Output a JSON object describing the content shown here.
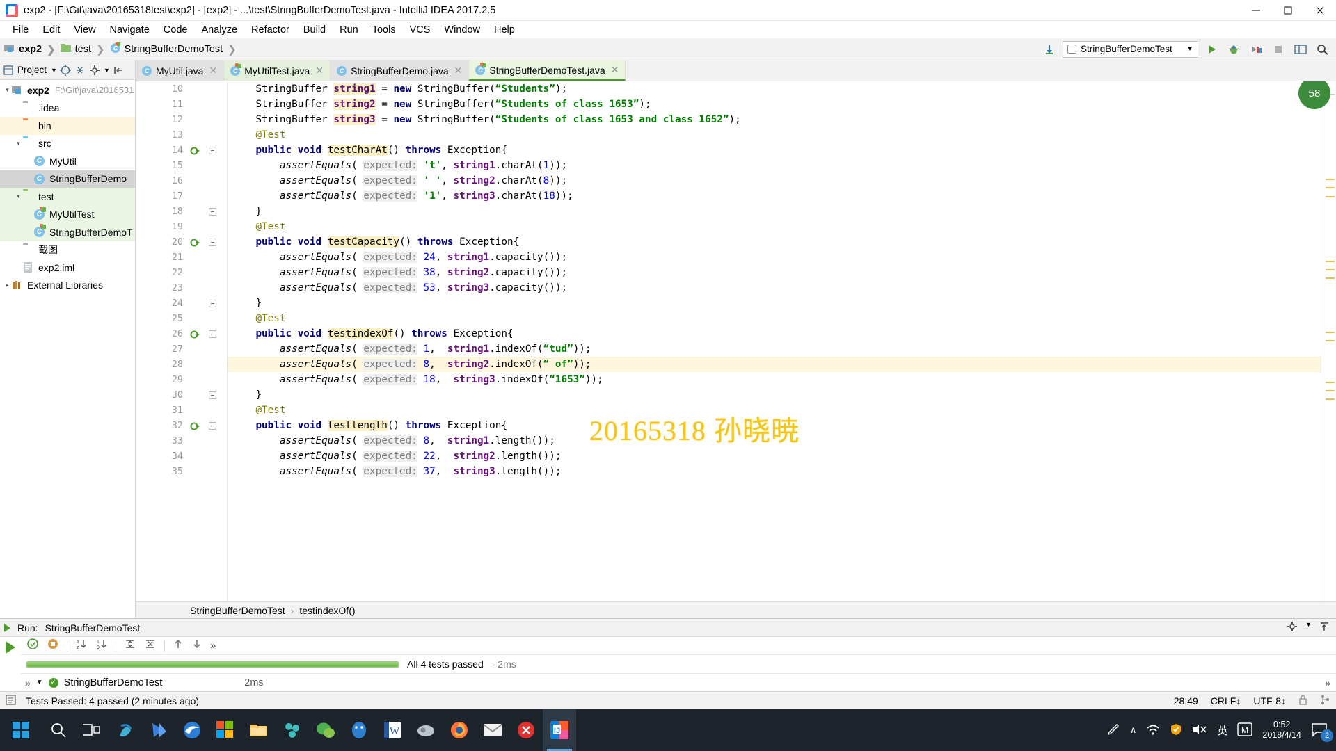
{
  "window": {
    "title": "exp2 - [F:\\Git\\java\\20165318test\\exp2] - [exp2] - ...\\test\\StringBufferDemoTest.java - IntelliJ IDEA 2017.2.5",
    "minimize_label": "─",
    "maximize_label": "❐",
    "close_label": "✕",
    "app_icon": "intellij-idea-icon"
  },
  "menubar": {
    "items": [
      "File",
      "Edit",
      "View",
      "Navigate",
      "Code",
      "Analyze",
      "Refactor",
      "Build",
      "Run",
      "Tools",
      "VCS",
      "Window",
      "Help"
    ]
  },
  "navbar": {
    "breadcrumbs": [
      {
        "label": "exp2",
        "icon": "module-icon"
      },
      {
        "label": "test",
        "icon": "folder-green-icon"
      },
      {
        "label": "StringBufferDemoTest",
        "icon": "test-class-icon"
      }
    ],
    "download_icon": "download-arrow-icon",
    "run_configuration": "StringBufferDemoTest",
    "run_icon": "run-green-triangle",
    "debug_icon": "debug-bug-icon",
    "coverage_icon": "run-with-coverage-icon",
    "stop_icon": "stop-square-icon",
    "layout_icon": "layout-icon",
    "search_icon": "search-icon"
  },
  "sidebar": {
    "title": "Project",
    "header_icons": [
      "project-view-icon",
      "target-icon",
      "collapse-all-icon",
      "gear-icon",
      "hide-icon"
    ],
    "tree": [
      {
        "label": "exp2",
        "sub": "F:\\Git\\java\\2016531",
        "icon": "module-icon",
        "indent": 0,
        "bold": true,
        "arrow": "▾",
        "state": "none"
      },
      {
        "label": ".idea",
        "sub": "",
        "icon": "folder-gray-icon",
        "indent": 1,
        "bold": false,
        "arrow": "",
        "state": "none"
      },
      {
        "label": "bin",
        "sub": "",
        "icon": "folder-orange-icon",
        "indent": 1,
        "bold": false,
        "arrow": "",
        "state": "ylw"
      },
      {
        "label": "src",
        "sub": "",
        "icon": "folder-blue-icon",
        "indent": 1,
        "bold": false,
        "arrow": "▾",
        "state": "none"
      },
      {
        "label": "MyUtil",
        "sub": "",
        "icon": "class-icon",
        "indent": 2,
        "bold": false,
        "arrow": "",
        "state": "none"
      },
      {
        "label": "StringBufferDemo",
        "sub": "",
        "icon": "class-icon",
        "indent": 2,
        "bold": false,
        "arrow": "",
        "state": "sel"
      },
      {
        "label": "test",
        "sub": "",
        "icon": "folder-green-icon",
        "indent": 1,
        "bold": false,
        "arrow": "▾",
        "state": "grn"
      },
      {
        "label": "MyUtilTest",
        "sub": "",
        "icon": "test-class-icon",
        "indent": 2,
        "bold": false,
        "arrow": "",
        "state": "grn"
      },
      {
        "label": "StringBufferDemoT",
        "sub": "",
        "icon": "test-class-icon",
        "indent": 2,
        "bold": false,
        "arrow": "",
        "state": "grn"
      },
      {
        "label": "截图",
        "sub": "",
        "icon": "folder-gray-icon",
        "indent": 1,
        "bold": false,
        "arrow": "",
        "state": "none"
      },
      {
        "label": "exp2.iml",
        "sub": "",
        "icon": "iml-icon",
        "indent": 1,
        "bold": false,
        "arrow": "",
        "state": "none"
      },
      {
        "label": "External Libraries",
        "sub": "",
        "icon": "library-icon",
        "indent": 0,
        "bold": false,
        "arrow": "▸",
        "state": "none"
      }
    ]
  },
  "editor": {
    "tabs": [
      {
        "label": "MyUtil.java",
        "icon": "class-icon",
        "state": "normal",
        "close": "✕"
      },
      {
        "label": "MyUtilTest.java",
        "icon": "test-class-icon",
        "state": "green",
        "close": "✕"
      },
      {
        "label": "StringBufferDemo.java",
        "icon": "class-icon",
        "state": "normal",
        "close": "✕"
      },
      {
        "label": "StringBufferDemoTest.java",
        "icon": "test-class-icon",
        "state": "active",
        "close": "✕"
      }
    ],
    "first_line_number": 10,
    "lines": [
      {
        "n": 10,
        "run": false,
        "fold": false,
        "hl": false,
        "html": "    <span class=\"plain\">StringBuffer </span><span class=\"fld hlname\">string1</span><span class=\"plain\"> = </span><span class=\"kw\">new</span><span class=\"plain\"> StringBuffer(</span><span class=\"str\">“Students”</span><span class=\"plain\">);</span>"
      },
      {
        "n": 11,
        "run": false,
        "fold": false,
        "hl": false,
        "html": "    <span class=\"plain\">StringBuffer </span><span class=\"fld hlname\">string2</span><span class=\"plain\"> = </span><span class=\"kw\">new</span><span class=\"plain\"> StringBuffer(</span><span class=\"str\">“Students of class 1653”</span><span class=\"plain\">);</span>"
      },
      {
        "n": 12,
        "run": false,
        "fold": false,
        "hl": false,
        "html": "    <span class=\"plain\">StringBuffer </span><span class=\"fld hlname\">string3</span><span class=\"plain\"> = </span><span class=\"kw\">new</span><span class=\"plain\"> StringBuffer(</span><span class=\"str\">“Students of class 1653 and class 1652”</span><span class=\"plain\">);</span>"
      },
      {
        "n": 13,
        "run": false,
        "fold": false,
        "hl": false,
        "html": "    <span class=\"ann\">@Test</span>"
      },
      {
        "n": 14,
        "run": true,
        "fold": true,
        "hl": false,
        "html": "    <span class=\"kw\">public void</span><span class=\"plain\"> </span><span class=\"hlname\">testCharAt</span><span class=\"plain\">() </span><span class=\"kw\">throws</span><span class=\"plain\"> Exception{</span>"
      },
      {
        "n": 15,
        "run": false,
        "fold": false,
        "hl": false,
        "html": "        <span class=\"stat\">assertEquals</span><span class=\"plain\">( </span><span class=\"param\">expected:</span><span class=\"plain\"> </span><span class=\"str\">'t'</span><span class=\"plain\">, </span><span class=\"fld\">string1</span><span class=\"plain\">.charAt(</span><span class=\"num\">1</span><span class=\"plain\">));</span>"
      },
      {
        "n": 16,
        "run": false,
        "fold": false,
        "hl": false,
        "html": "        <span class=\"stat\">assertEquals</span><span class=\"plain\">( </span><span class=\"param\">expected:</span><span class=\"plain\"> </span><span class=\"str\">' '</span><span class=\"plain\">, </span><span class=\"fld\">string2</span><span class=\"plain\">.charAt(</span><span class=\"num\">8</span><span class=\"plain\">));</span>"
      },
      {
        "n": 17,
        "run": false,
        "fold": false,
        "hl": false,
        "html": "        <span class=\"stat\">assertEquals</span><span class=\"plain\">( </span><span class=\"param\">expected:</span><span class=\"plain\"> </span><span class=\"str\">'1'</span><span class=\"plain\">, </span><span class=\"fld\">string3</span><span class=\"plain\">.charAt(</span><span class=\"num\">18</span><span class=\"plain\">));</span>"
      },
      {
        "n": 18,
        "run": false,
        "fold": true,
        "hl": false,
        "html": "    <span class=\"plain\">}</span>"
      },
      {
        "n": 19,
        "run": false,
        "fold": false,
        "hl": false,
        "html": "    <span class=\"ann\">@Test</span>"
      },
      {
        "n": 20,
        "run": true,
        "fold": true,
        "hl": false,
        "html": "    <span class=\"kw\">public void</span><span class=\"plain\"> </span><span class=\"hlname\">testCapacity</span><span class=\"plain\">() </span><span class=\"kw\">throws</span><span class=\"plain\"> Exception{</span>"
      },
      {
        "n": 21,
        "run": false,
        "fold": false,
        "hl": false,
        "html": "        <span class=\"stat\">assertEquals</span><span class=\"plain\">( </span><span class=\"param\">expected:</span><span class=\"plain\"> </span><span class=\"num\">24</span><span class=\"plain\">, </span><span class=\"fld\">string1</span><span class=\"plain\">.capacity());</span>"
      },
      {
        "n": 22,
        "run": false,
        "fold": false,
        "hl": false,
        "html": "        <span class=\"stat\">assertEquals</span><span class=\"plain\">( </span><span class=\"param\">expected:</span><span class=\"plain\"> </span><span class=\"num\">38</span><span class=\"plain\">, </span><span class=\"fld\">string2</span><span class=\"plain\">.capacity());</span>"
      },
      {
        "n": 23,
        "run": false,
        "fold": false,
        "hl": false,
        "html": "        <span class=\"stat\">assertEquals</span><span class=\"plain\">( </span><span class=\"param\">expected:</span><span class=\"plain\"> </span><span class=\"num\">53</span><span class=\"plain\">, </span><span class=\"fld\">string3</span><span class=\"plain\">.capacity());</span>"
      },
      {
        "n": 24,
        "run": false,
        "fold": true,
        "hl": false,
        "html": "    <span class=\"plain\">}</span>"
      },
      {
        "n": 25,
        "run": false,
        "fold": false,
        "hl": false,
        "html": "    <span class=\"ann\">@Test</span>"
      },
      {
        "n": 26,
        "run": true,
        "fold": true,
        "hl": false,
        "html": "    <span class=\"kw\">public void</span><span class=\"plain\"> </span><span class=\"hlname\">testindexOf</span><span class=\"plain\">() </span><span class=\"kw\">throws</span><span class=\"plain\"> Exception{</span>"
      },
      {
        "n": 27,
        "run": false,
        "fold": false,
        "hl": false,
        "html": "        <span class=\"stat\">assertEquals</span><span class=\"plain\">( </span><span class=\"param\">expected:</span><span class=\"plain\"> </span><span class=\"num\">1</span><span class=\"plain\">,  </span><span class=\"fld\">string1</span><span class=\"plain\">.indexOf(</span><span class=\"str\">“tud”</span><span class=\"plain\">));</span>"
      },
      {
        "n": 28,
        "run": false,
        "fold": false,
        "hl": true,
        "html": "        <span class=\"stat\">assertEquals</span><span class=\"plain\">( </span><span class=\"param\">expected:</span><span class=\"plain\"> </span><span class=\"num\">8</span><span class=\"plain\">,  </span><span class=\"fld\">string2</span><span class=\"plain\">.indexOf(</span><span class=\"str\">“ of”</span><span class=\"plain\">));</span>"
      },
      {
        "n": 29,
        "run": false,
        "fold": false,
        "hl": false,
        "html": "        <span class=\"stat\">assertEquals</span><span class=\"plain\">( </span><span class=\"param\">expected:</span><span class=\"plain\"> </span><span class=\"num\">18</span><span class=\"plain\">,  </span><span class=\"fld\">string3</span><span class=\"plain\">.indexOf(</span><span class=\"str\">“1653”</span><span class=\"plain\">));</span>"
      },
      {
        "n": 30,
        "run": false,
        "fold": true,
        "hl": false,
        "html": "    <span class=\"plain\">}</span>"
      },
      {
        "n": 31,
        "run": false,
        "fold": false,
        "hl": false,
        "html": "    <span class=\"ann\">@Test</span>"
      },
      {
        "n": 32,
        "run": true,
        "fold": true,
        "hl": false,
        "html": "    <span class=\"kw\">public void</span><span class=\"plain\"> </span><span class=\"hlname\">testlength</span><span class=\"plain\">() </span><span class=\"kw\">throws</span><span class=\"plain\"> Exception{</span>"
      },
      {
        "n": 33,
        "run": false,
        "fold": false,
        "hl": false,
        "html": "        <span class=\"stat\">assertEquals</span><span class=\"plain\">( </span><span class=\"param\">expected:</span><span class=\"plain\"> </span><span class=\"num\">8</span><span class=\"plain\">,  </span><span class=\"fld\">string1</span><span class=\"plain\">.length());</span>"
      },
      {
        "n": 34,
        "run": false,
        "fold": false,
        "hl": false,
        "html": "        <span class=\"stat\">assertEquals</span><span class=\"plain\">( </span><span class=\"param\">expected:</span><span class=\"plain\"> </span><span class=\"num\">22</span><span class=\"plain\">,  </span><span class=\"fld\">string2</span><span class=\"plain\">.length());</span>"
      },
      {
        "n": 35,
        "run": false,
        "fold": false,
        "hl": false,
        "html": "        <span class=\"stat\">assertEquals</span><span class=\"plain\">( </span><span class=\"param\">expected:</span><span class=\"plain\"> </span><span class=\"num\">37</span><span class=\"plain\">,  </span><span class=\"fld\">string3</span><span class=\"plain\">.length());</span>"
      }
    ],
    "watermark": "20165318 孙晓暁",
    "watermark_color": "#f5c518",
    "breadcrumb": {
      "class": "StringBufferDemoTest",
      "method": "testindexOf()",
      "separator": "›"
    },
    "inspection_badge": "58"
  },
  "run_panel": {
    "title": "Run:",
    "config_name": "StringBufferDemoTest",
    "gear_icon": "gear-icon",
    "hide_icon": "hide-icon",
    "play_icon": "run-green-triangle",
    "toolbar_icons": [
      "rerun-tests-icon",
      "toggle-auto-test-icon",
      "sort-alphabetically-icon",
      "sort-by-duration-icon",
      "expand-all-icon",
      "collapse-all-icon",
      "prev-failed-icon",
      "next-failed-icon",
      "more-icon"
    ],
    "result_text": "All 4 tests passed",
    "result_time": "- 2ms",
    "progress_percent": 100,
    "tree": {
      "name": "StringBufferDemoTest",
      "time": "2ms",
      "status_icon": "check-green-icon",
      "expand": "▾"
    }
  },
  "statusbar": {
    "message": "Tests Passed: 4 passed (2 minutes ago)",
    "caret": "28:49",
    "line_separator": "CRLF↕",
    "encoding": "UTF-8↕",
    "lock_icon": "lock-icon",
    "branch_icon": "git-branch-icon"
  },
  "taskbar": {
    "start_icon": "windows-start-icon",
    "items": [
      {
        "icon": "search-circle-icon",
        "name": "cortana-search",
        "active": false
      },
      {
        "icon": "task-view-icon",
        "name": "task-view",
        "active": false
      },
      {
        "icon": "app-blue-swirl",
        "name": "app-1",
        "active": false
      },
      {
        "icon": "app-blue-bird",
        "name": "app-2",
        "active": false
      },
      {
        "icon": "edge-icon",
        "name": "microsoft-edge",
        "active": false
      },
      {
        "icon": "store-icon",
        "name": "microsoft-store",
        "active": false
      },
      {
        "icon": "file-explorer-icon",
        "name": "file-explorer",
        "active": false
      },
      {
        "icon": "app-teal-molecule",
        "name": "app-3",
        "active": false
      },
      {
        "icon": "wechat-icon",
        "name": "wechat",
        "active": false
      },
      {
        "icon": "qq-icon",
        "name": "qq",
        "active": false
      },
      {
        "icon": "word-icon",
        "name": "microsoft-word",
        "active": false
      },
      {
        "icon": "app-gray-pen",
        "name": "app-4",
        "active": false
      },
      {
        "icon": "firefox-icon",
        "name": "firefox",
        "active": false
      },
      {
        "icon": "mail-icon",
        "name": "mail",
        "active": false
      },
      {
        "icon": "app-red-circle",
        "name": "app-5",
        "active": false
      },
      {
        "icon": "intellij-idea-icon",
        "name": "intellij-idea",
        "active": true
      }
    ],
    "tray": {
      "pen_icon": "windows-ink-icon",
      "chevron_icon": "∧",
      "network_icon": "wifi-icon",
      "shield_icon": "security-icon",
      "volume_icon": "volume-muted-icon",
      "ime_label": "英",
      "ime_icon": "ime-m-icon",
      "time": "0:52",
      "date": "2018/4/14",
      "notification_count": "2"
    }
  }
}
